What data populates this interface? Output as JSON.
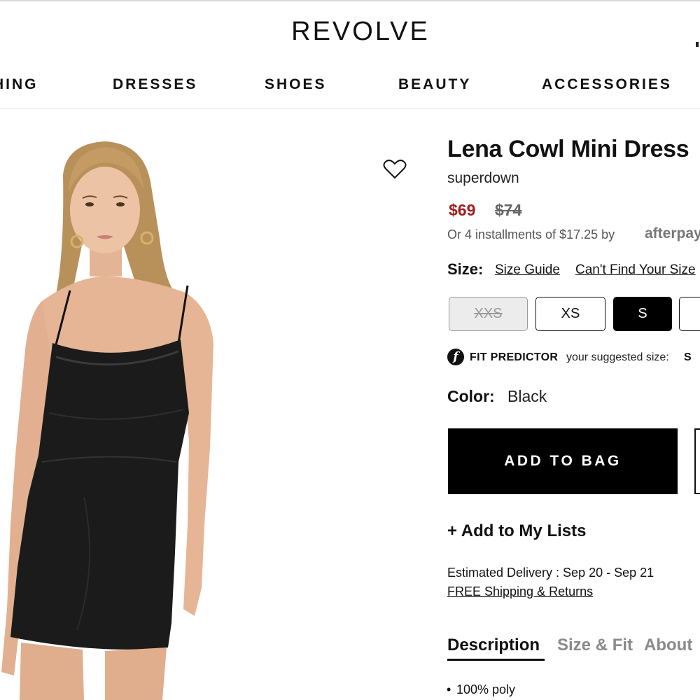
{
  "header": {
    "logo": "REVOLVE",
    "nav": [
      "HING",
      "DRESSES",
      "SHOES",
      "BEAUTY",
      "ACCESSORIES"
    ]
  },
  "product": {
    "title": "Lena Cowl Mini Dress",
    "brand": "superdown",
    "price_sale": "$69",
    "price_original": "$74",
    "installments": "Or 4 installments of $17.25 by",
    "afterpay": "afterpay",
    "size_label": "Size:",
    "size_guide": "Size Guide",
    "cant_find": "Can't Find Your Size",
    "sizes": [
      {
        "label": "XXS",
        "state": "unavailable"
      },
      {
        "label": "XS",
        "state": "available"
      },
      {
        "label": "S",
        "state": "selected"
      },
      {
        "label": "",
        "state": "available"
      }
    ],
    "fit_predictor": {
      "icon": "f",
      "title": "FIT PREDICTOR",
      "text": "your suggested size:",
      "size": "S"
    },
    "color_label": "Color:",
    "color_value": "Black",
    "add_to_bag": "ADD TO BAG",
    "add_to_lists": "+ Add to My Lists",
    "delivery": "Estimated Delivery : Sep 20 - Sep 21",
    "shipping": "FREE Shipping & Returns",
    "tabs": [
      "Description",
      "Size & Fit",
      "About"
    ],
    "details": [
      "100% poly"
    ]
  },
  "colors": {
    "sale": "#a11d1d",
    "button": "#000000"
  },
  "icons": {
    "wishlist": "heart-outline-icon",
    "fit_predictor": "fit-predictor-icon"
  }
}
